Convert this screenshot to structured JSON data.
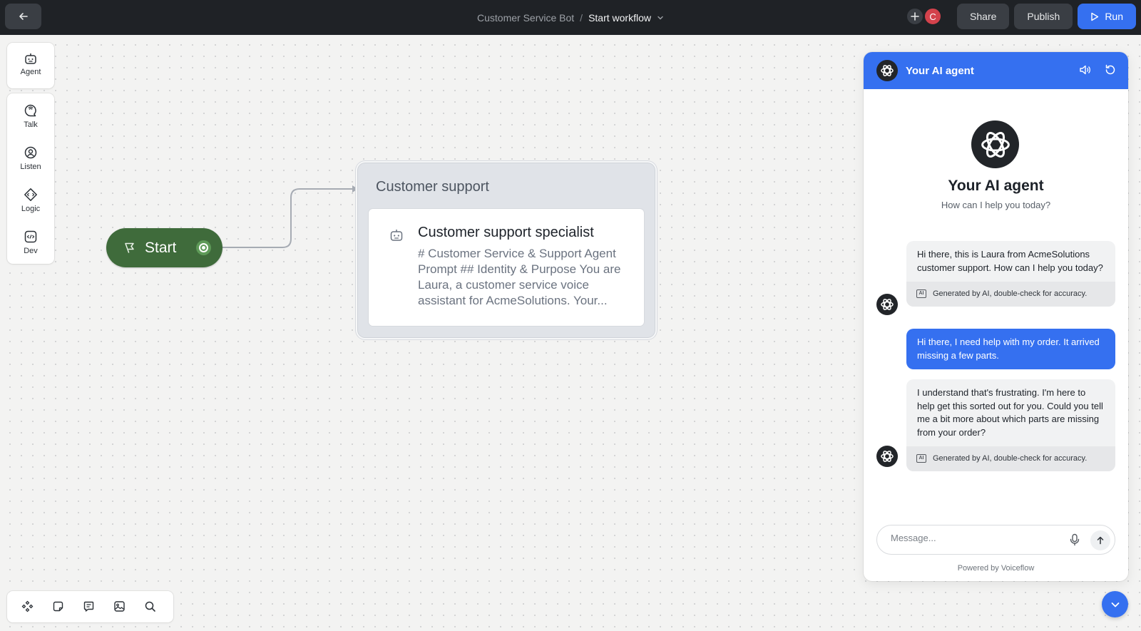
{
  "topbar": {
    "project": "Customer Service Bot",
    "separator": "/",
    "workflow": "Start workflow",
    "collaborator_initial": "C",
    "share_label": "Share",
    "publish_label": "Publish",
    "run_label": "Run"
  },
  "toolbar": {
    "agent_label": "Agent",
    "tools": [
      {
        "label": "Talk"
      },
      {
        "label": "Listen"
      },
      {
        "label": "Logic"
      },
      {
        "label": "Dev"
      }
    ]
  },
  "canvas": {
    "start_label": "Start",
    "block": {
      "title": "Customer support",
      "step_title": "Customer support specialist",
      "step_description": "# Customer Service & Support Agent Prompt ## Identity & Purpose You are Laura, a customer service voice assistant for AcmeSolutions. Your..."
    }
  },
  "chat": {
    "header_title": "Your AI agent",
    "agent_name": "Your AI agent",
    "agent_subtitle": "How can I help you today?",
    "messages": [
      {
        "role": "bot",
        "text": "Hi there, this is Laura from AcmeSolutions customer support. How can I help you today?",
        "note": "Generated by AI, double-check for accuracy."
      },
      {
        "role": "user",
        "text": "Hi there, I need help with my order. It arrived missing a few parts."
      },
      {
        "role": "bot",
        "text": "I understand that's frustrating. I'm here to help get this sorted out for you. Could you tell me a bit more about which parts are missing from your order?",
        "note": "Generated by AI, double-check for accuracy."
      }
    ],
    "input_placeholder": "Message...",
    "powered_by": "Powered by Voiceflow",
    "ai_badge": "AI"
  },
  "colors": {
    "accent": "#3570f0",
    "topbar": "#1f2226",
    "start_node": "#3f6b3b",
    "block_bg": "#e0e3e8"
  }
}
